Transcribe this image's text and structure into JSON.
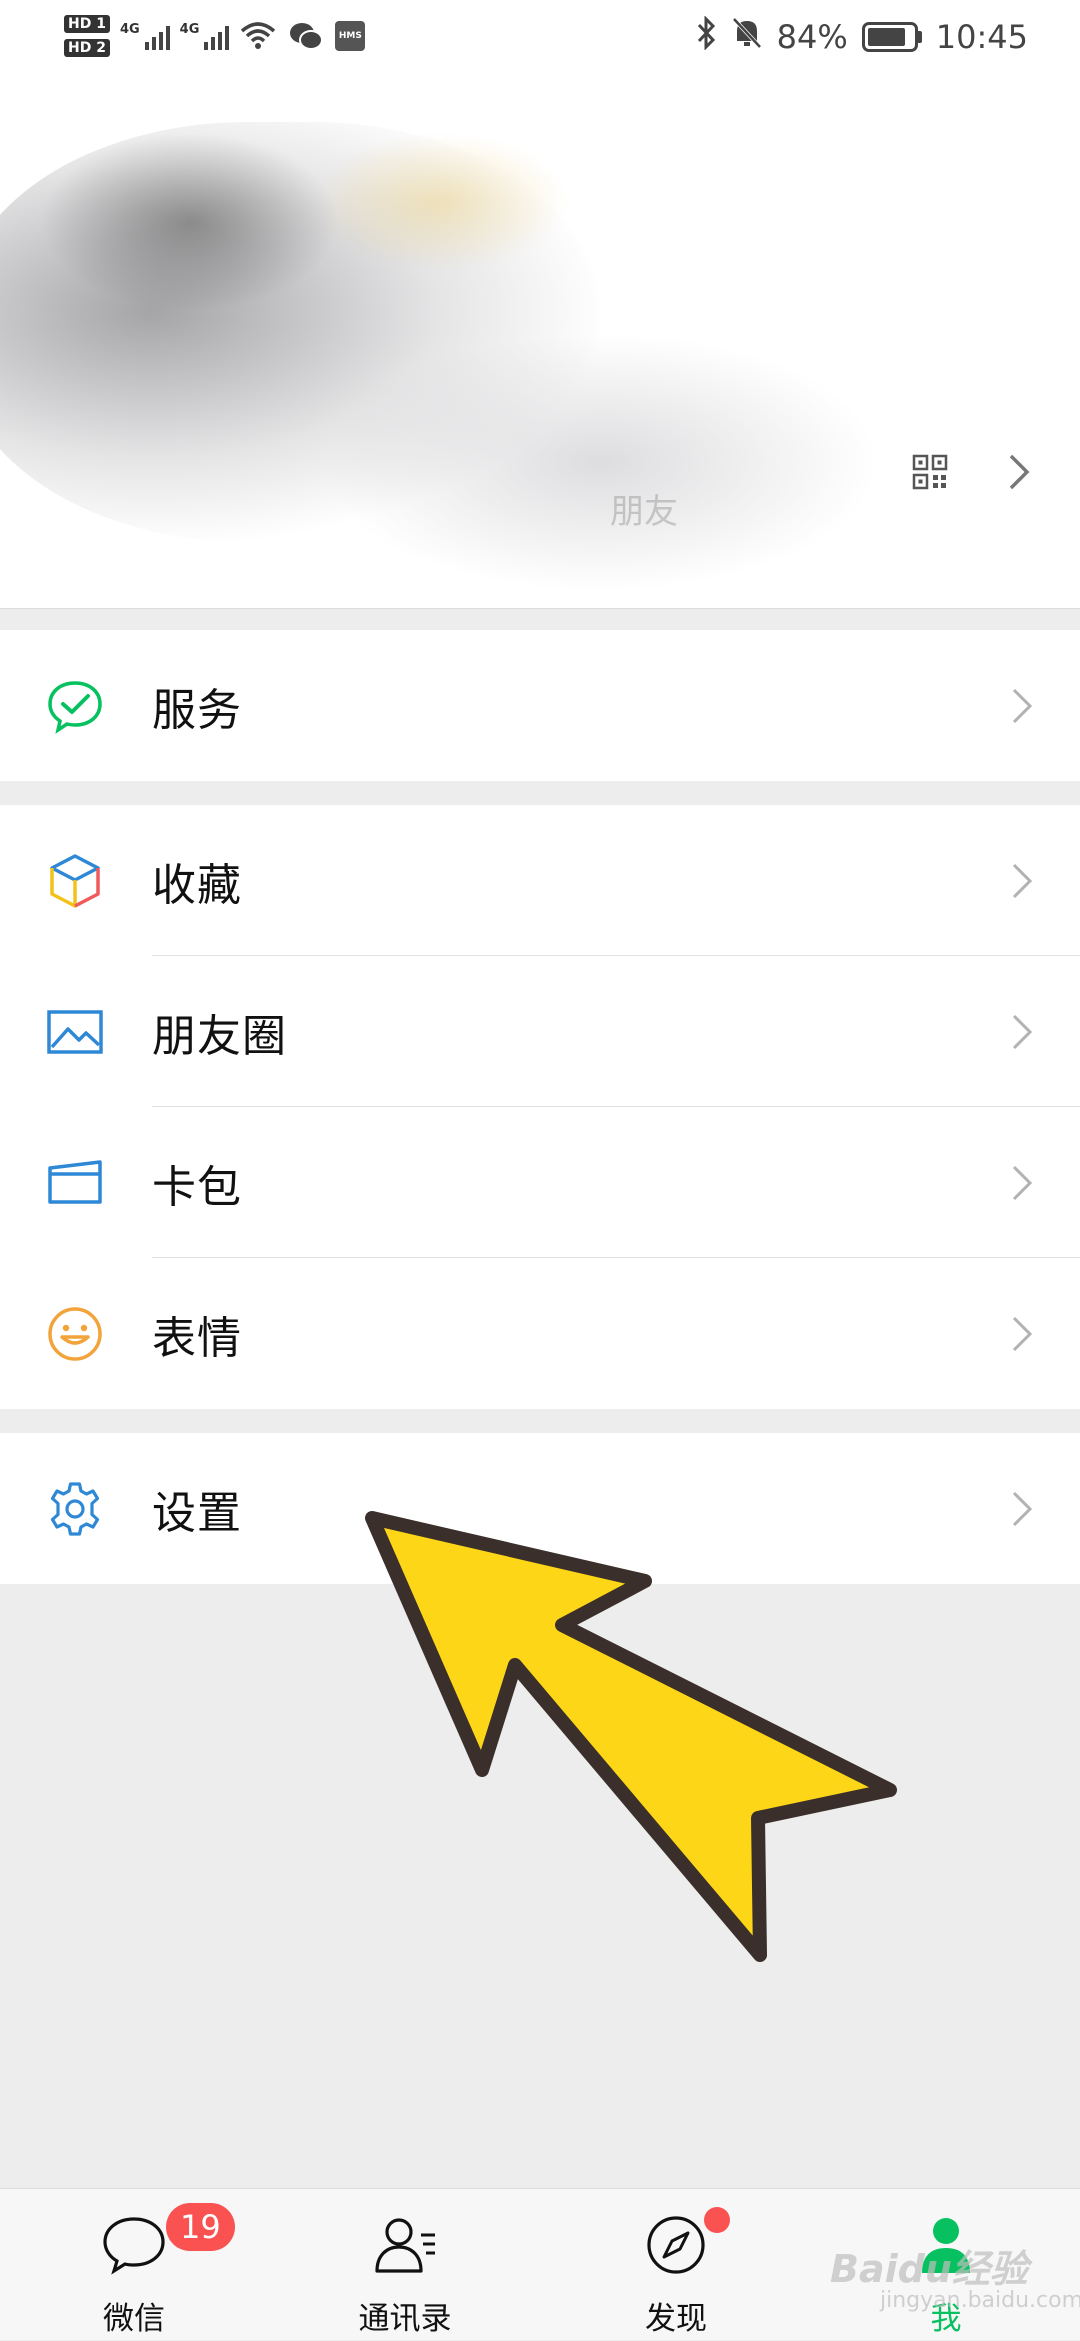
{
  "status_bar": {
    "sim1": "HD 1",
    "sim2": "HD 2",
    "network1": "4G",
    "network2": "4G",
    "hms": "HMS",
    "battery_percent": "84%",
    "battery_level": 0.84,
    "time": "10:45",
    "icons": [
      "wifi-icon",
      "wechat-icon",
      "bluetooth-icon",
      "mute-bell-icon",
      "battery-icon"
    ]
  },
  "header": {
    "faint_text": "朋友",
    "qr_icon": "qr-code-icon",
    "arrow_icon": "chevron-right-icon"
  },
  "groups": [
    {
      "items": [
        {
          "label": "服务",
          "icon": "service-icon",
          "color": "#07c160"
        }
      ]
    },
    {
      "items": [
        {
          "label": "收藏",
          "icon": "favorites-cube-icon",
          "color": "#e6a23c"
        },
        {
          "label": "朋友圈",
          "icon": "moments-image-icon",
          "color": "#2f88d6"
        },
        {
          "label": "卡包",
          "icon": "card-wallet-icon",
          "color": "#2f88d6"
        },
        {
          "label": "表情",
          "icon": "sticker-smile-icon",
          "color": "#f2a33a"
        }
      ]
    },
    {
      "items": [
        {
          "label": "设置",
          "icon": "settings-gear-icon",
          "color": "#2f88d6"
        }
      ]
    }
  ],
  "tabbar": {
    "tabs": [
      {
        "label": "微信",
        "icon": "chat-bubble-icon",
        "badge": "19"
      },
      {
        "label": "通讯录",
        "icon": "contacts-icon"
      },
      {
        "label": "发现",
        "icon": "compass-icon",
        "dot": true
      },
      {
        "label": "我",
        "icon": "me-person-icon",
        "active": true
      }
    ],
    "active_color": "#07c160",
    "badge_color": "#fa5151"
  },
  "watermark": {
    "text": "Baidu经验",
    "sub": "jingyan.baidu.com"
  },
  "annotation": {
    "type": "yellow-arrow",
    "color": "#fdd717"
  }
}
